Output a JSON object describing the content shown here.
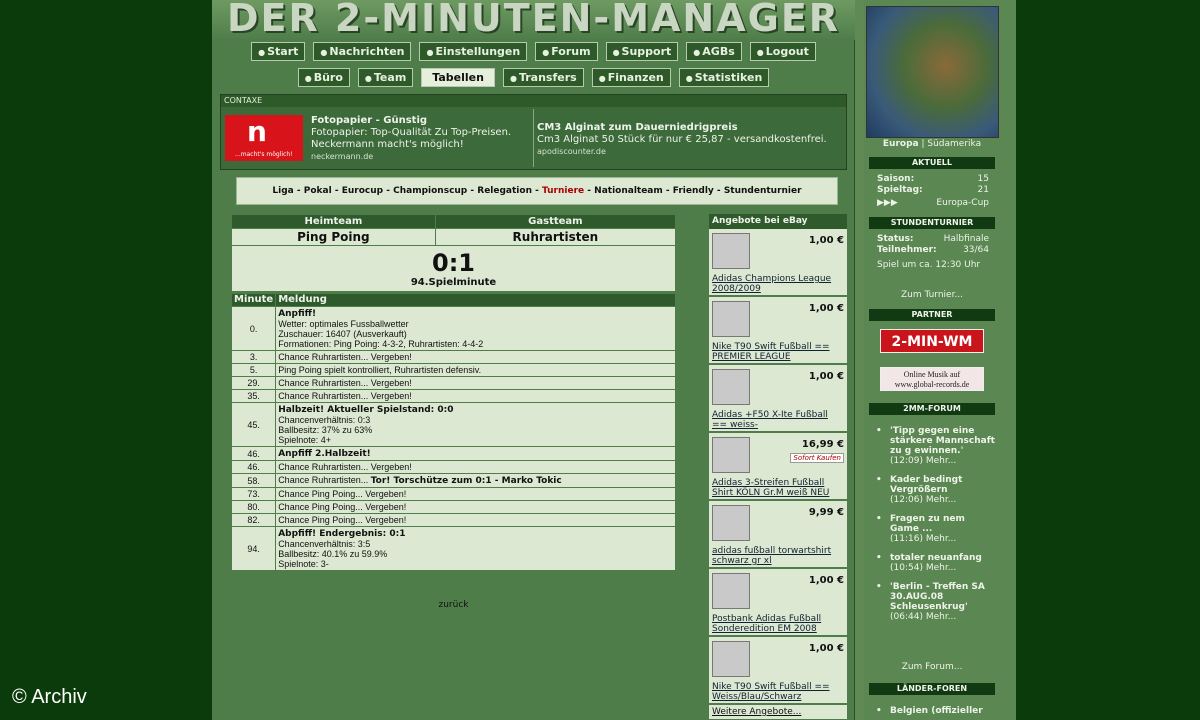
{
  "title": "DER 2-MINUTEN-MANAGER",
  "nav_main": [
    "Start",
    "Nachrichten",
    "Einstellungen",
    "Forum",
    "Support",
    "AGBs",
    "Logout"
  ],
  "nav_sub": [
    "Büro",
    "Team",
    "Tabellen",
    "Transfers",
    "Finanzen",
    "Statistiken"
  ],
  "nav_sub_active": "Tabellen",
  "ads": {
    "label": "CONTAXE",
    "logo_text": "n",
    "logo_sub": "...macht's möglich!",
    "ad1_title": "Fotopapier - Günstig",
    "ad1_line1": "Fotopapier: Top-Qualität Zu Top-Preisen.",
    "ad1_line2": "Neckermann macht's möglich!",
    "ad1_url": "neckermann.de",
    "ad2_title": "CM3 Alginat zum Dauerniedrigpreis",
    "ad2_line1": "Cm3 Alginat 50 Stück für nur € 25,87 - versandkostenfrei.",
    "ad2_url": "apodiscounter.de"
  },
  "tabs": [
    "Liga",
    "Pokal",
    "Eurocup",
    "Championscup",
    "Relegation",
    "Turniere",
    "Nationalteam",
    "Friendly",
    "Stundenturnier"
  ],
  "match": {
    "home_label": "Heimteam",
    "away_label": "Gastteam",
    "home": "Ping Poing",
    "away": "Ruhrartisten",
    "score": "0:1",
    "minute": "94.Spielminute"
  },
  "log_headers": {
    "minute": "Minute",
    "message": "Meldung"
  },
  "events": [
    {
      "min": "0.",
      "bold": "Anpfiff!",
      "lines": [
        "Wetter: optimales Fussballwetter",
        "Zuschauer: 16407 (Ausverkauft)",
        "Formationen: Ping Poing: 4-3-2, Ruhrartisten: 4-4-2"
      ]
    },
    {
      "min": "3.",
      "text": "Chance Ruhrartisten... Vergeben!"
    },
    {
      "min": "5.",
      "text": "Ping Poing spielt kontrolliert, Ruhrartisten defensiv."
    },
    {
      "min": "29.",
      "text": "Chance Ruhrartisten... Vergeben!"
    },
    {
      "min": "35.",
      "text": "Chance Ruhrartisten... Vergeben!"
    },
    {
      "min": "45.",
      "bold": "Halbzeit! Aktueller Spielstand: 0:0",
      "lines": [
        "Chancenverhältnis: 0:3",
        "Ballbesitz: 37% zu 63%",
        "Spielnote: 4+"
      ]
    },
    {
      "min": "46.",
      "bold": "Anpfiff 2.Halbzeit!"
    },
    {
      "min": "46.",
      "text": "Chance Ruhrartisten... Vergeben!"
    },
    {
      "min": "58.",
      "text": "Chance Ruhrartisten... ",
      "tail": "Tor! Torschütze zum 0:1 - Marko Tokic"
    },
    {
      "min": "73.",
      "text": "Chance Ping Poing... Vergeben!"
    },
    {
      "min": "80.",
      "text": "Chance Ping Poing... Vergeben!"
    },
    {
      "min": "82.",
      "text": "Chance Ping Poing... Vergeben!"
    },
    {
      "min": "94.",
      "bold": "Abpfiff! Endergebnis: 0:1",
      "lines": [
        "Chancenverhältnis: 3:5",
        "Ballbesitz: 40.1% zu 59.9%",
        "Spielnote: 3-"
      ]
    }
  ],
  "back_link": "zurück",
  "ebay": {
    "header": "Angebote bei eBay",
    "items": [
      {
        "price": "1,00 €",
        "title": "Adidas Champions League 2008/2009",
        "img": "white-ball-icon"
      },
      {
        "price": "1,00 €",
        "title": "Nike T90 Swift Fußball == PREMIER LEAGUE",
        "img": "red-ball-icon"
      },
      {
        "price": "1,00 €",
        "title": "Adidas +F50 X-Ite Fußball == weiss-",
        "img": "silver-ball-icon"
      },
      {
        "price": "16,99 €",
        "title": "Adidas 3-Streifen Fußball Shirt KÖLN Gr.M weiß NEU",
        "img": "shirt-icon",
        "badge": "Sofort Kaufen"
      },
      {
        "price": "9,99 €",
        "title": "adidas fußball torwartshirt schwarz gr xl",
        "img": "goalkeeper-shirt-icon"
      },
      {
        "price": "1,00 €",
        "title": "Postbank Adidas Fußball Sonderedition EM 2008",
        "img": "yellow-ball-icon"
      },
      {
        "price": "1,00 €",
        "title": "Nike T90 Swift Fußball == Weiss/Blau/Schwarz",
        "img": "blue-ball-icon"
      }
    ],
    "more": "Weitere Angebote..."
  },
  "sidebar": {
    "map_region": "Europa",
    "map_other": "Südamerika",
    "aktuell_title": "AKTUELL",
    "saison_label": "Saison:",
    "saison": "15",
    "spieltag_label": "Spieltag:",
    "spieltag": "21",
    "cup_arrows": "▶▶▶",
    "cup": "Europa-Cup",
    "stunden_title": "STUNDENTURNIER",
    "status_label": "Status:",
    "status": "Halbfinale",
    "teil_label": "Teilnehmer:",
    "teil": "33/64",
    "spiel_info": "Spiel um ca. 12:30 Uhr",
    "turnier_link": "Zum Turnier...",
    "partner_title": "PARTNER",
    "partner1": "2-MIN-WM",
    "partner2_line1": "Online Musik auf",
    "partner2_line2": "www.global-records.de",
    "forum_title": "2MM-FORUM",
    "forum": [
      {
        "title": "'Tipp gegen eine stärkere Mannschaft zu g ewinnen.'",
        "time": "(12:09) Mehr..."
      },
      {
        "title": "Kader bedingt Vergrößern",
        "time": "(12:06) Mehr..."
      },
      {
        "title": "Fragen zu nem Game ...",
        "time": "(11:16) Mehr..."
      },
      {
        "title": "totaler neuanfang",
        "time": "(10:54) Mehr..."
      },
      {
        "title": "'Berlin - Treffen SA 30.AUG.08 Schleusenkrug'",
        "time": "(06:44) Mehr..."
      }
    ],
    "forum_link": "Zum Forum...",
    "laender_title": "LÄNDER-FOREN",
    "laender_item": "Belgien (offizieller"
  },
  "copyright": "© Archiv"
}
